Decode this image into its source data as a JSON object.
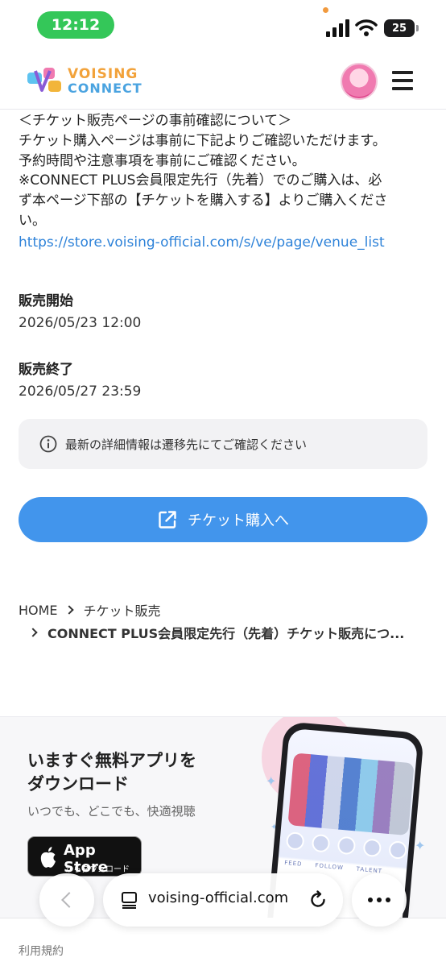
{
  "status_bar": {
    "time": "12:12",
    "battery": "25"
  },
  "header": {
    "logo_top": "VOISING",
    "logo_bottom": "CONNECT"
  },
  "notice": {
    "lines": [
      "＜チケット販売ページの事前確認について＞",
      "チケット購入ページは事前に下記よりご確認いただけます。",
      "予約時間や注意事項を事前にご確認ください。",
      "※CONNECT PLUS会員限定先行（先着）でのご購入は、必",
      "ず本ページ下部の【チケットを購入する】よりご購入くださ",
      "い。"
    ],
    "link": "https://store.voising-official.com/s/ve/page/venue_list"
  },
  "sale_start": {
    "label": "販売開始",
    "value": "2026/05/23 12:00"
  },
  "sale_end": {
    "label": "販売終了",
    "value": "2026/05/27 23:59"
  },
  "info_box": {
    "text": "最新の詳細情報は遷移先にてご確認ください",
    "icon": "info-icon"
  },
  "buy_button": {
    "label": "チケット購入へ",
    "icon": "external-link-icon"
  },
  "breadcrumb": {
    "home": "HOME",
    "category": "チケット販売",
    "current": "CONNECT PLUS会員限定先行（先着）チケット販売につ..."
  },
  "app_banner": {
    "title_line1": "いますぐ無料アプリを",
    "title_line2": "ダウンロード",
    "subtitle": "いつでも、どこでも、快適視聴",
    "appstore_big": "App Store",
    "appstore_small": "からダウンロード",
    "phone_tabs": "FEED　　FOLLOW　　TALENT"
  },
  "safari": {
    "url": "voising-official.com"
  },
  "footer": {
    "terms": "利用規約"
  },
  "colors": {
    "accent": "#4295ec",
    "link": "#2f83d9",
    "time_pill": "#34c759"
  }
}
